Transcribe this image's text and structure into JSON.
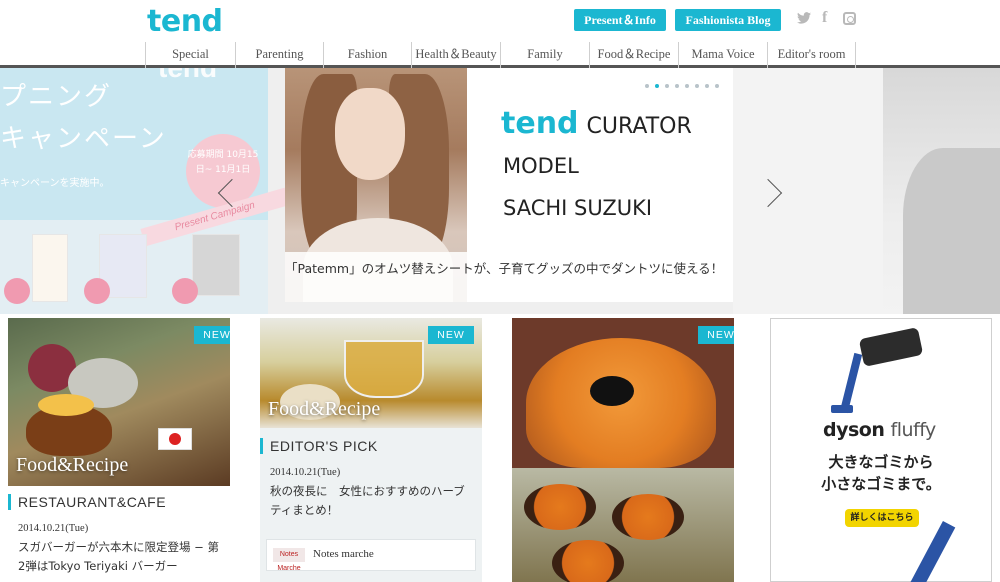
{
  "header": {
    "logo": "tend",
    "buttons": {
      "present": "Present＆Info",
      "blog": "Fashionista Blog"
    },
    "social": [
      "twitter-icon",
      "facebook-icon",
      "instagram-icon"
    ]
  },
  "nav": {
    "items": [
      {
        "label": "Special"
      },
      {
        "label": "Parenting"
      },
      {
        "label": "Fashion"
      },
      {
        "label": "Health＆Beauty"
      },
      {
        "label": "Family"
      },
      {
        "label": "Food＆Recipe"
      },
      {
        "label": "Mama Voice"
      },
      {
        "label": "Editor's room"
      }
    ]
  },
  "hero": {
    "left_banner": {
      "line1": "プニング",
      "line2": "キャンペーン",
      "small": "キャンペーンを実施中。",
      "circle": "応募期間 10月15日~ 11月1日",
      "ribbon": "Present Campaign",
      "top_logo": "tend"
    },
    "slide": {
      "brand": "tend",
      "line1": "CURATOR",
      "line2": "MODEL",
      "line3": "SACHI SUZUKI",
      "caption": "「Patemm」のオムツ替えシートが、子育てグッズの中でダントツに使える！",
      "dots": 8,
      "active_dot": 2
    }
  },
  "cards": [
    {
      "badge": "NEW",
      "image_caption": "Food&Recipe",
      "section": "RESTAURANT&CAFE",
      "date": "2014.10.21(Tue)",
      "text": "スガバーガーが六本木に限定登場 − 第2弾はTokyo Teriyaki バーガー"
    },
    {
      "badge": "NEW",
      "image_caption": "Food&Recipe",
      "section": "EDITOR'S PICK",
      "date": "2014.10.21(Tue)",
      "text": "秋の夜長に　女性におすすめのハーブティまとめ！",
      "partner_logo": "Notes Marche",
      "partner": "Notes marche"
    },
    {
      "badge": "NEW"
    }
  ],
  "ad": {
    "brand": "dyson",
    "product": "fluffy",
    "copy_line1": "大きなゴミから",
    "copy_line2": "小さなゴミまで。",
    "button": "詳しくはこちら"
  },
  "colors": {
    "accent": "#1bb7d1",
    "nav_border": "#555555",
    "ad_button": "#f2d400"
  }
}
